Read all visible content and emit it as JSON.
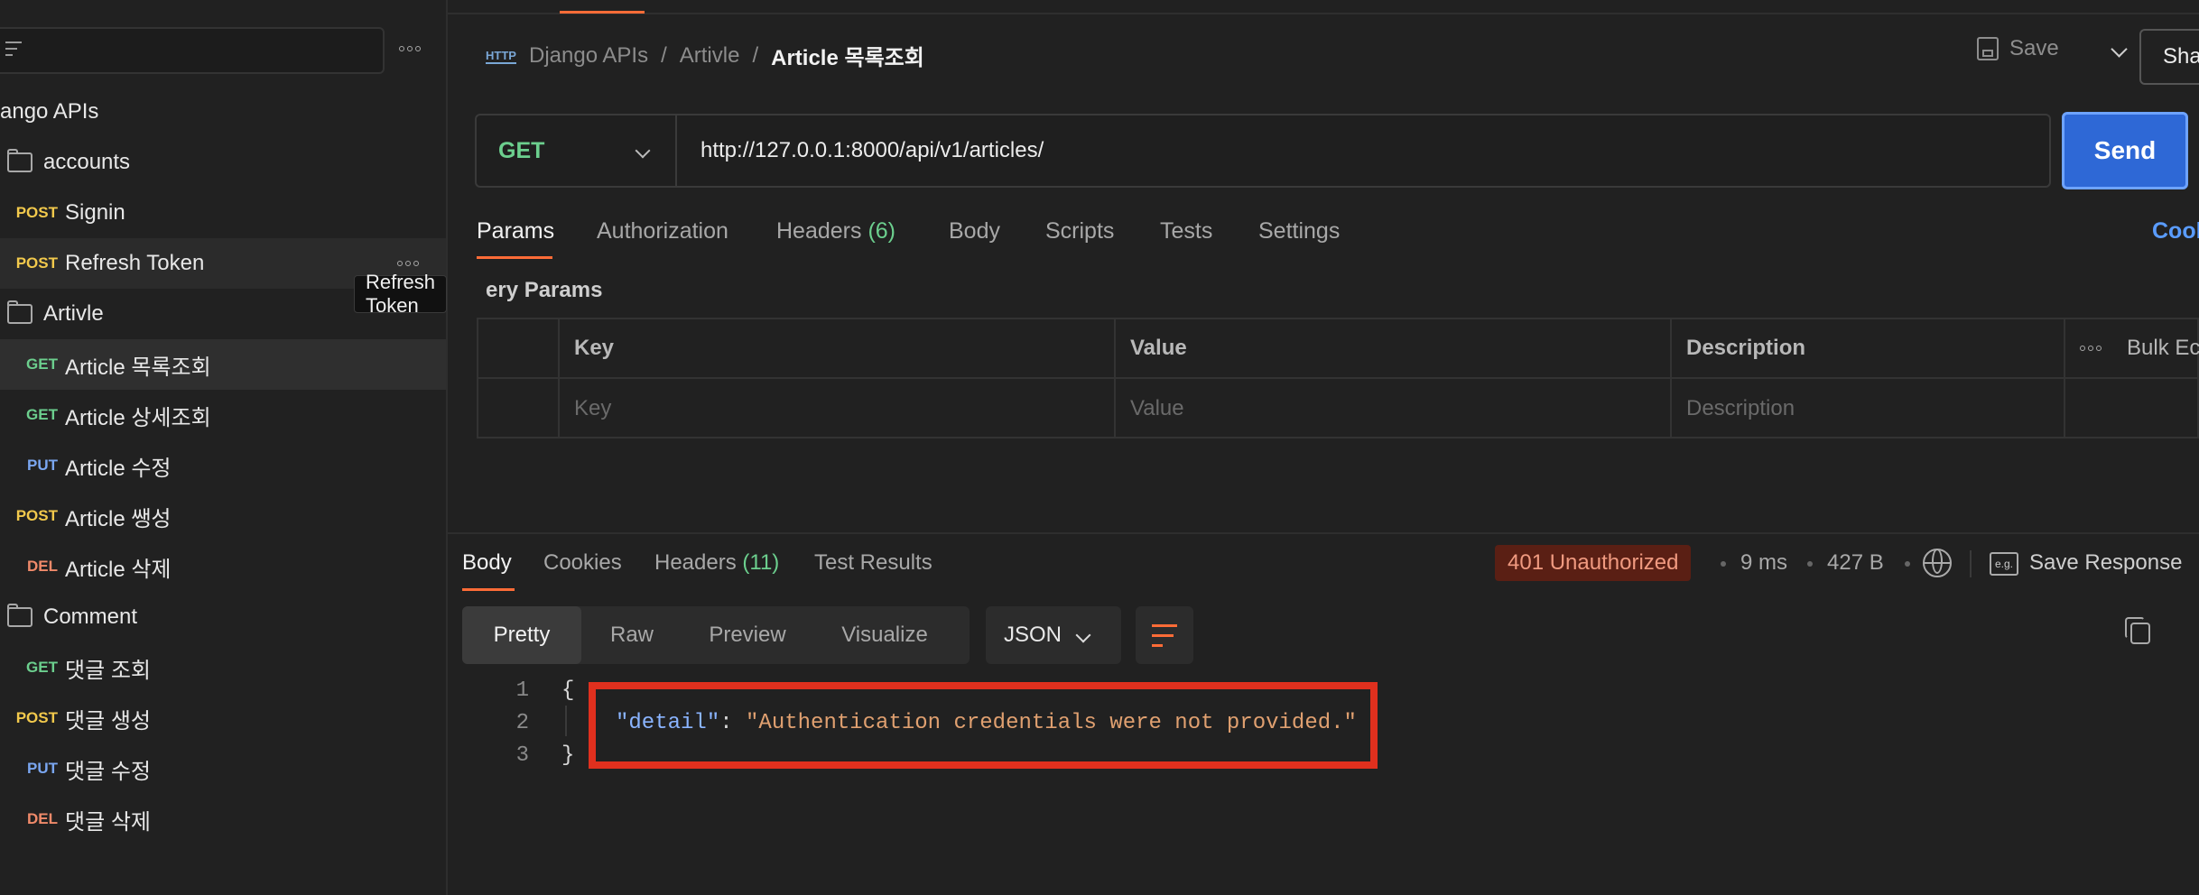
{
  "sidebar": {
    "collection": "ango APIs",
    "items": [
      {
        "type": "folder",
        "label": "accounts"
      },
      {
        "type": "request",
        "method": "POST",
        "label": "Signin"
      },
      {
        "type": "request",
        "method": "POST",
        "label": "Refresh Token"
      },
      {
        "type": "folder",
        "label": "Artivle"
      },
      {
        "type": "request",
        "method": "GET",
        "label": "Article 목록조회"
      },
      {
        "type": "request",
        "method": "GET",
        "label": "Article 상세조회"
      },
      {
        "type": "request",
        "method": "PUT",
        "label": "Article 수정"
      },
      {
        "type": "request",
        "method": "POST",
        "label": "Article 쌩성"
      },
      {
        "type": "request",
        "method": "DEL",
        "label": "Article 삭제"
      },
      {
        "type": "folder",
        "label": "Comment"
      },
      {
        "type": "request",
        "method": "GET",
        "label": "댓글 조회"
      },
      {
        "type": "request",
        "method": "POST",
        "label": "댓글 생성"
      },
      {
        "type": "request",
        "method": "PUT",
        "label": "댓글 수정"
      },
      {
        "type": "request",
        "method": "DEL",
        "label": "댓글 삭제"
      }
    ],
    "tooltip": "Refresh Token"
  },
  "header": {
    "http_icon": "HTTP",
    "breadcrumb": [
      "Django APIs",
      "Artivle",
      "Article 목록조회"
    ],
    "separator": "/",
    "save_label": "Save",
    "share_label": "Sha"
  },
  "request": {
    "method": "GET",
    "url": "http://127.0.0.1:8000/api/v1/articles/",
    "send_label": "Send",
    "tabs": [
      {
        "label": "Params"
      },
      {
        "label": "Authorization"
      },
      {
        "label": "Headers",
        "count": "(6)"
      },
      {
        "label": "Body"
      },
      {
        "label": "Scripts"
      },
      {
        "label": "Tests"
      },
      {
        "label": "Settings"
      }
    ],
    "cookies_label": "Cook",
    "query_title": "ery Params",
    "table": {
      "headers": [
        "Key",
        "Value",
        "Description"
      ],
      "bulk_edit": "Bulk Ec",
      "placeholders": [
        "Key",
        "Value",
        "Description"
      ]
    }
  },
  "response": {
    "tabs": [
      {
        "label": "Body"
      },
      {
        "label": "Cookies"
      },
      {
        "label": "Headers",
        "count": "(11)"
      },
      {
        "label": "Test Results"
      }
    ],
    "status": "401 Unauthorized",
    "time": "9 ms",
    "size": "427 B",
    "eg_icon": "e.g.",
    "save_response": "Save Response",
    "formats": [
      "Pretty",
      "Raw",
      "Preview",
      "Visualize"
    ],
    "language": "JSON",
    "line_numbers": [
      "1",
      "2",
      "3"
    ],
    "code": {
      "open": "{",
      "key": "\"detail\"",
      "colon": ": ",
      "value": "\"Authentication credentials were not provided.\"",
      "close": "}"
    }
  },
  "colors": {
    "accent": "#ff6c37",
    "send": "#2e68d6",
    "get": "#6ccf8e",
    "post": "#f2c94c",
    "put": "#7aa6f0",
    "del": "#f08a6a",
    "highlight": "#e0301e"
  }
}
